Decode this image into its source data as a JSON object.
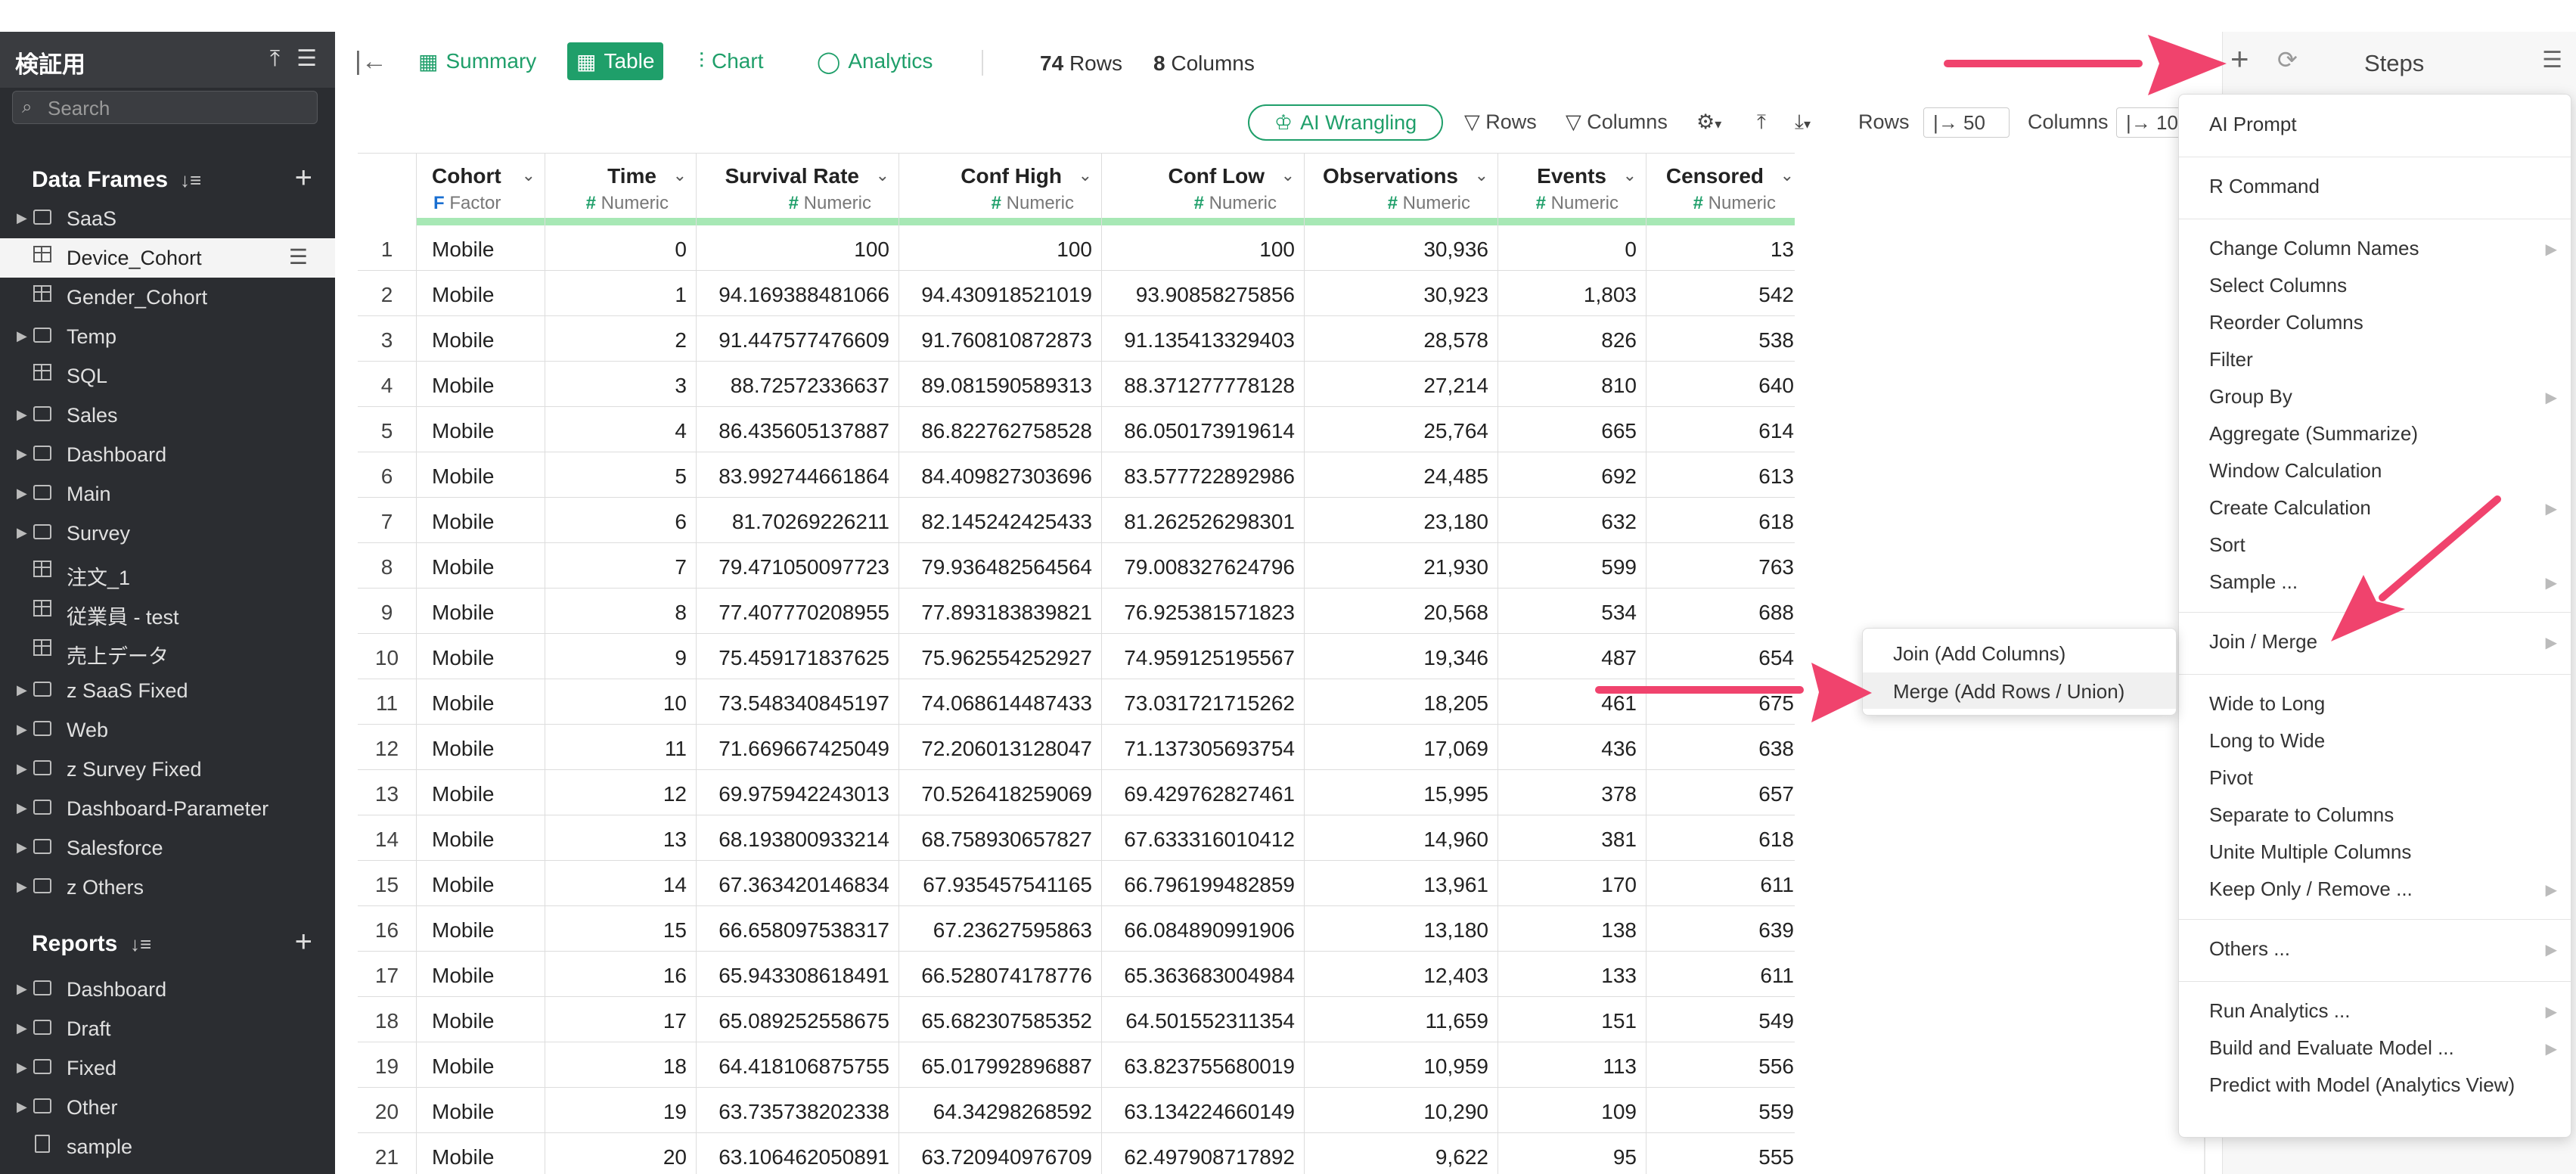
{
  "sidebar": {
    "title": "検証用",
    "search_placeholder": "Search",
    "data_frames_label": "Data Frames",
    "reports_label": "Reports",
    "data_frames": [
      {
        "type": "folder",
        "label": "SaaS"
      },
      {
        "type": "table",
        "label": "Device_Cohort",
        "active": true
      },
      {
        "type": "table",
        "label": "Gender_Cohort"
      },
      {
        "type": "folder",
        "label": "Temp"
      },
      {
        "type": "table",
        "label": "SQL"
      },
      {
        "type": "folder",
        "label": "Sales"
      },
      {
        "type": "folder",
        "label": "Dashboard"
      },
      {
        "type": "folder",
        "label": "Main"
      },
      {
        "type": "folder",
        "label": "Survey"
      },
      {
        "type": "table",
        "label": "注文_1"
      },
      {
        "type": "table",
        "label": "従業員 - test"
      },
      {
        "type": "table",
        "label": "売上データ"
      },
      {
        "type": "folder",
        "label": "z SaaS Fixed"
      },
      {
        "type": "folder",
        "label": "Web"
      },
      {
        "type": "folder",
        "label": "z Survey Fixed"
      },
      {
        "type": "folder",
        "label": "Dashboard-Parameter"
      },
      {
        "type": "folder",
        "label": "Salesforce"
      },
      {
        "type": "folder",
        "label": "z Others"
      }
    ],
    "reports": [
      {
        "type": "folder",
        "label": "Dashboard"
      },
      {
        "type": "folder",
        "label": "Draft"
      },
      {
        "type": "folder",
        "label": "Fixed"
      },
      {
        "type": "folder",
        "label": "Other"
      },
      {
        "type": "file",
        "label": "sample"
      }
    ]
  },
  "toolbar": {
    "tabs": [
      {
        "label": "Summary",
        "icon": "summary-icon",
        "active": false
      },
      {
        "label": "Table",
        "icon": "table-icon",
        "active": true
      },
      {
        "label": "Chart",
        "icon": "chart-icon",
        "active": false
      },
      {
        "label": "Analytics",
        "icon": "analytics-icon",
        "active": false
      }
    ],
    "rows_count": "74",
    "rows_label": "Rows",
    "cols_count": "8",
    "cols_label": "Columns"
  },
  "toolbar2": {
    "ai_label": "AI Wrangling",
    "rows_filter": "Rows",
    "columns_filter": "Columns",
    "rows_label": "Rows",
    "rows_value": "|→ 50",
    "columns_label": "Columns",
    "columns_value": "|→ 10"
  },
  "table": {
    "columns": [
      {
        "name": "Cohort",
        "type": "Factor",
        "mark": "F"
      },
      {
        "name": "Time",
        "type": "Numeric",
        "mark": "#"
      },
      {
        "name": "Survival Rate",
        "type": "Numeric",
        "mark": "#"
      },
      {
        "name": "Conf High",
        "type": "Numeric",
        "mark": "#"
      },
      {
        "name": "Conf Low",
        "type": "Numeric",
        "mark": "#"
      },
      {
        "name": "Observations",
        "type": "Numeric",
        "mark": "#"
      },
      {
        "name": "Events",
        "type": "Numeric",
        "mark": "#"
      },
      {
        "name": "Censored",
        "type": "Numeric",
        "mark": "#"
      }
    ],
    "rows": [
      [
        "1",
        "Mobile",
        "0",
        "100",
        "100",
        "100",
        "30,936",
        "0",
        "13"
      ],
      [
        "2",
        "Mobile",
        "1",
        "94.169388481066",
        "94.430918521019",
        "93.90858275856",
        "30,923",
        "1,803",
        "542"
      ],
      [
        "3",
        "Mobile",
        "2",
        "91.447577476609",
        "91.760810872873",
        "91.135413329403",
        "28,578",
        "826",
        "538"
      ],
      [
        "4",
        "Mobile",
        "3",
        "88.72572336637",
        "89.081590589313",
        "88.371277778128",
        "27,214",
        "810",
        "640"
      ],
      [
        "5",
        "Mobile",
        "4",
        "86.435605137887",
        "86.822762758528",
        "86.050173919614",
        "25,764",
        "665",
        "614"
      ],
      [
        "6",
        "Mobile",
        "5",
        "83.992744661864",
        "84.409827303696",
        "83.577722892986",
        "24,485",
        "692",
        "613"
      ],
      [
        "7",
        "Mobile",
        "6",
        "81.70269226211",
        "82.145242425433",
        "81.262526298301",
        "23,180",
        "632",
        "618"
      ],
      [
        "8",
        "Mobile",
        "7",
        "79.471050097723",
        "79.936482564564",
        "79.008327624796",
        "21,930",
        "599",
        "763"
      ],
      [
        "9",
        "Mobile",
        "8",
        "77.407770208955",
        "77.893183839821",
        "76.925381571823",
        "20,568",
        "534",
        "688"
      ],
      [
        "10",
        "Mobile",
        "9",
        "75.459171837625",
        "75.962554252927",
        "74.959125195567",
        "19,346",
        "487",
        "654"
      ],
      [
        "11",
        "Mobile",
        "10",
        "73.548340845197",
        "74.068614487433",
        "73.031721715262",
        "18,205",
        "461",
        "675"
      ],
      [
        "12",
        "Mobile",
        "11",
        "71.669667425049",
        "72.206013128047",
        "71.137305693754",
        "17,069",
        "436",
        "638"
      ],
      [
        "13",
        "Mobile",
        "12",
        "69.975942243013",
        "70.526418259069",
        "69.429762827461",
        "15,995",
        "378",
        "657"
      ],
      [
        "14",
        "Mobile",
        "13",
        "68.193800933214",
        "68.758930657827",
        "67.633316010412",
        "14,960",
        "381",
        "618"
      ],
      [
        "15",
        "Mobile",
        "14",
        "67.363420146834",
        "67.935457541165",
        "66.796199482859",
        "13,961",
        "170",
        "611"
      ],
      [
        "16",
        "Mobile",
        "15",
        "66.658097538317",
        "67.23627595863",
        "66.084890991906",
        "13,180",
        "138",
        "639"
      ],
      [
        "17",
        "Mobile",
        "16",
        "65.943308618491",
        "66.528074178776",
        "65.363683004984",
        "12,403",
        "133",
        "611"
      ],
      [
        "18",
        "Mobile",
        "17",
        "65.089252558675",
        "65.682307585352",
        "64.501552311354",
        "11,659",
        "151",
        "549"
      ],
      [
        "19",
        "Mobile",
        "18",
        "64.418106875755",
        "65.017992896887",
        "63.823755680019",
        "10,959",
        "113",
        "556"
      ],
      [
        "20",
        "Mobile",
        "19",
        "63.735738202338",
        "64.34298268592",
        "63.134224660149",
        "10,290",
        "109",
        "559"
      ],
      [
        "21",
        "Mobile",
        "20",
        "63.106462050891",
        "63.720940976709",
        "62.497908717892",
        "9,622",
        "95",
        "555"
      ]
    ]
  },
  "steps": {
    "title": "Steps"
  },
  "add_menu": {
    "groups": [
      [
        {
          "label": "AI Prompt"
        }
      ],
      [
        {
          "label": "R Command"
        }
      ],
      [
        {
          "label": "Change Column Names",
          "sub": true
        },
        {
          "label": "Select Columns"
        },
        {
          "label": "Reorder Columns"
        },
        {
          "label": "Filter"
        },
        {
          "label": "Group By",
          "sub": true
        },
        {
          "label": "Aggregate (Summarize)"
        },
        {
          "label": "Window Calculation"
        },
        {
          "label": "Create Calculation",
          "sub": true
        },
        {
          "label": "Sort"
        },
        {
          "label": "Sample ...",
          "sub": true
        }
      ],
      [
        {
          "label": "Join / Merge",
          "sub": true
        }
      ],
      [
        {
          "label": "Wide to Long"
        },
        {
          "label": "Long to Wide"
        },
        {
          "label": "Pivot"
        },
        {
          "label": "Separate to Columns"
        },
        {
          "label": "Unite Multiple Columns"
        },
        {
          "label": "Keep Only / Remove ...",
          "sub": true
        }
      ],
      [
        {
          "label": "Others ...",
          "sub": true
        }
      ],
      [
        {
          "label": "Run Analytics ...",
          "sub": true
        },
        {
          "label": "Build and Evaluate Model ...",
          "sub": true
        },
        {
          "label": "Predict with Model (Analytics View)"
        }
      ]
    ]
  },
  "join_submenu": {
    "items": [
      {
        "label": "Join (Add Columns)"
      },
      {
        "label": "Merge (Add Rows / Union)",
        "highlighted": true
      }
    ]
  },
  "colors": {
    "accent": "#1f9f6a",
    "annotation_arrow": "#f0436d",
    "sidebar_bg": "#2b2d31"
  }
}
